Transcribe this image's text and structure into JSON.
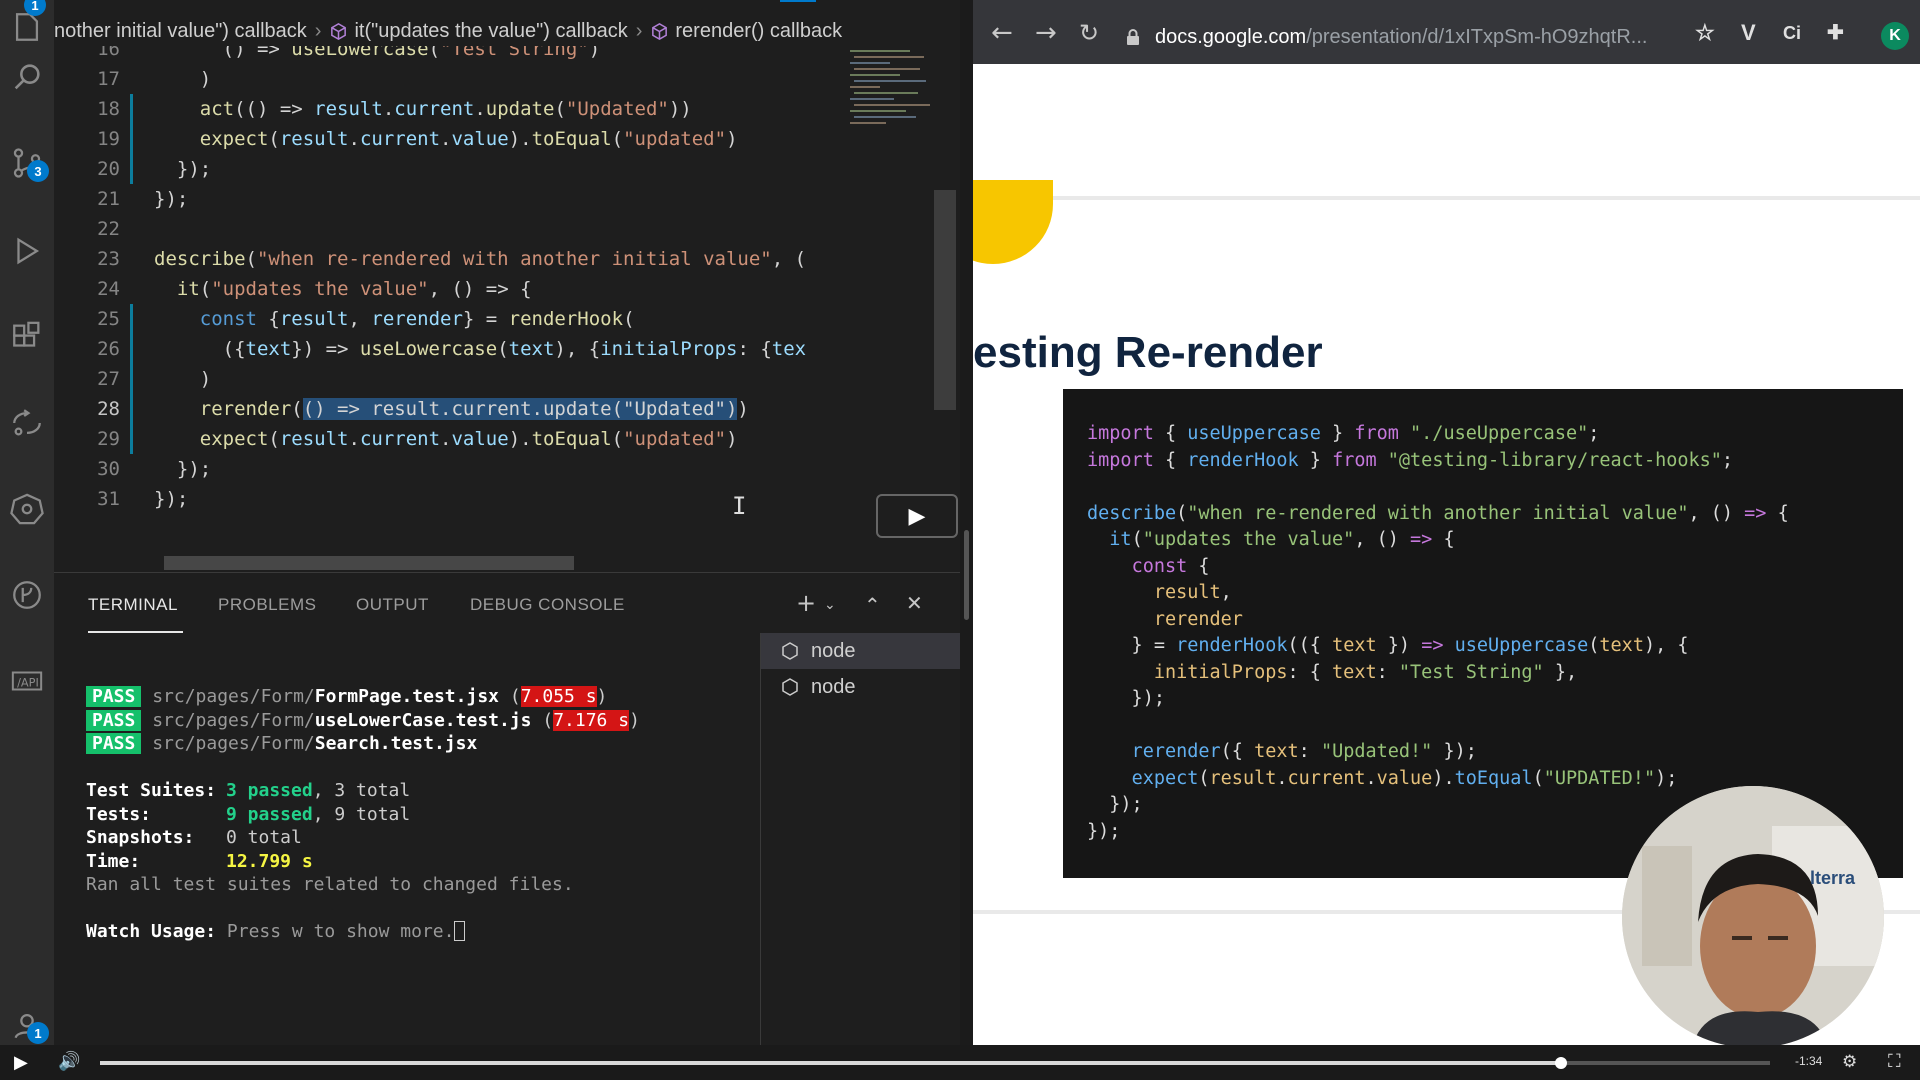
{
  "vscode": {
    "badges": {
      "explorer": "1",
      "source_control": "3",
      "accounts": "1"
    },
    "breadcrumb": [
      "nother initial value\") callback",
      "it(\"updates the value\") callback",
      "rerender() callback"
    ],
    "code_lines": [
      {
        "num": "16",
        "tokens": [
          [
            "pun",
            "      () => "
          ],
          [
            "fn",
            "useLowercase"
          ],
          [
            "pun",
            "("
          ],
          [
            "str",
            "\"Test String\""
          ],
          [
            "pun",
            ")"
          ]
        ]
      },
      {
        "num": "17",
        "tokens": [
          [
            "pun",
            "    )"
          ]
        ]
      },
      {
        "num": "18",
        "tokens": [
          [
            "pun",
            "    "
          ],
          [
            "fn",
            "act"
          ],
          [
            "pun",
            "(() => "
          ],
          [
            "var",
            "result"
          ],
          [
            "pun",
            "."
          ],
          [
            "var",
            "current"
          ],
          [
            "pun",
            "."
          ],
          [
            "fn",
            "update"
          ],
          [
            "pun",
            "("
          ],
          [
            "str",
            "\"Updated\""
          ],
          [
            "pun",
            "))"
          ]
        ]
      },
      {
        "num": "19",
        "tokens": [
          [
            "pun",
            "    "
          ],
          [
            "fn",
            "expect"
          ],
          [
            "pun",
            "("
          ],
          [
            "var",
            "result"
          ],
          [
            "pun",
            "."
          ],
          [
            "var",
            "current"
          ],
          [
            "pun",
            "."
          ],
          [
            "var",
            "value"
          ],
          [
            "pun",
            ")."
          ],
          [
            "fn",
            "toEqual"
          ],
          [
            "pun",
            "("
          ],
          [
            "str",
            "\"updated\""
          ],
          [
            "pun",
            ")"
          ]
        ]
      },
      {
        "num": "20",
        "tokens": [
          [
            "pun",
            "  });"
          ]
        ]
      },
      {
        "num": "21",
        "tokens": [
          [
            "pun",
            "});"
          ]
        ]
      },
      {
        "num": "22",
        "tokens": []
      },
      {
        "num": "23",
        "tokens": [
          [
            "fn",
            "describe"
          ],
          [
            "pun",
            "("
          ],
          [
            "str",
            "\"when re-rendered with another initial value\""
          ],
          [
            "pun",
            ", ("
          ]
        ]
      },
      {
        "num": "24",
        "tokens": [
          [
            "pun",
            "  "
          ],
          [
            "fn",
            "it"
          ],
          [
            "pun",
            "("
          ],
          [
            "str",
            "\"updates the value\""
          ],
          [
            "pun",
            ", () => {"
          ]
        ]
      },
      {
        "num": "25",
        "tokens": [
          [
            "pun",
            "    "
          ],
          [
            "kw",
            "const"
          ],
          [
            "pun",
            " {"
          ],
          [
            "var",
            "result"
          ],
          [
            "pun",
            ", "
          ],
          [
            "var",
            "rerender"
          ],
          [
            "pun",
            "} = "
          ],
          [
            "fn",
            "renderHook"
          ],
          [
            "pun",
            "("
          ]
        ]
      },
      {
        "num": "26",
        "tokens": [
          [
            "pun",
            "      ({"
          ],
          [
            "var",
            "text"
          ],
          [
            "pun",
            "}) => "
          ],
          [
            "fn",
            "useLowercase"
          ],
          [
            "pun",
            "("
          ],
          [
            "var",
            "text"
          ],
          [
            "pun",
            "), {"
          ],
          [
            "var",
            "initialProps"
          ],
          [
            "pun",
            ": {"
          ],
          [
            "var",
            "tex"
          ]
        ]
      },
      {
        "num": "27",
        "tokens": [
          [
            "pun",
            "    )"
          ]
        ]
      },
      {
        "num": "28",
        "tokens": [
          [
            "pun",
            "    "
          ],
          [
            "fn",
            "rerender"
          ],
          [
            "pun",
            "("
          ],
          [
            "sel",
            "() => result.current.update(\"Updated\")"
          ],
          [
            "pun",
            ")"
          ]
        ]
      },
      {
        "num": "29",
        "tokens": [
          [
            "pun",
            "    "
          ],
          [
            "fn",
            "expect"
          ],
          [
            "pun",
            "("
          ],
          [
            "var",
            "result"
          ],
          [
            "pun",
            "."
          ],
          [
            "var",
            "current"
          ],
          [
            "pun",
            "."
          ],
          [
            "var",
            "value"
          ],
          [
            "pun",
            ")."
          ],
          [
            "fn",
            "toEqual"
          ],
          [
            "pun",
            "("
          ],
          [
            "str",
            "\"updated\""
          ],
          [
            "pun",
            ")"
          ]
        ]
      },
      {
        "num": "30",
        "tokens": [
          [
            "pun",
            "  });"
          ]
        ]
      },
      {
        "num": "31",
        "tokens": [
          [
            "pun",
            "});"
          ]
        ]
      }
    ],
    "panel_tabs": [
      "TERMINAL",
      "PROBLEMS",
      "OUTPUT",
      "DEBUG CONSOLE"
    ],
    "terminal": {
      "results": [
        {
          "status": "PASS",
          "dir": "src/pages/Form/",
          "file": "FormPage.test.jsx",
          "time": "7.055 s"
        },
        {
          "status": "PASS",
          "dir": "src/pages/Form/",
          "file": "useLowerCase.test.js",
          "time": "7.176 s"
        },
        {
          "status": "PASS",
          "dir": "src/pages/Form/",
          "file": "Search.test.jsx",
          "time": ""
        }
      ],
      "suites_label": "Test Suites:",
      "suites_passed": "3 passed",
      "suites_total": ", 3 total",
      "tests_label": "Tests:",
      "tests_passed": "9 passed",
      "tests_total": ", 9 total",
      "snapshots_label": "Snapshots:",
      "snapshots_value": "0 total",
      "time_label": "Time:",
      "time_value": "12.799 s",
      "ran_note": "Ran all test suites related to changed files.",
      "watch_label": "Watch Usage:",
      "watch_text": "Press w to show more."
    },
    "terminal_instances": [
      "node",
      "node"
    ]
  },
  "browser": {
    "url_host": "docs.google.com",
    "url_path": "/presentation/d/1xITxpSm-hO9zhqtR...",
    "profile_initial": "K",
    "slide_title": "esting Re-render",
    "slide_code_lines": [
      [
        [
          "s-kw",
          "import"
        ],
        [
          "s-plain",
          " { "
        ],
        [
          "s-fn",
          "useUppercase"
        ],
        [
          "s-plain",
          " } "
        ],
        [
          "s-kw",
          "from"
        ],
        [
          "s-plain",
          " "
        ],
        [
          "s-str",
          "\"./useUppercase\""
        ],
        [
          "s-plain",
          ";"
        ]
      ],
      [
        [
          "s-kw",
          "import"
        ],
        [
          "s-plain",
          " { "
        ],
        [
          "s-fn",
          "renderHook"
        ],
        [
          "s-plain",
          " } "
        ],
        [
          "s-kw",
          "from"
        ],
        [
          "s-plain",
          " "
        ],
        [
          "s-str",
          "\"@testing-library/react-hooks\""
        ],
        [
          "s-plain",
          ";"
        ]
      ],
      [],
      [
        [
          "s-fn",
          "describe"
        ],
        [
          "s-plain",
          "("
        ],
        [
          "s-str",
          "\"when re-rendered with another initial value\""
        ],
        [
          "s-plain",
          ", () "
        ],
        [
          "s-kw",
          "=>"
        ],
        [
          "s-plain",
          " {"
        ]
      ],
      [
        [
          "s-plain",
          "  "
        ],
        [
          "s-fn",
          "it"
        ],
        [
          "s-plain",
          "("
        ],
        [
          "s-str",
          "\"updates the value\""
        ],
        [
          "s-plain",
          ", () "
        ],
        [
          "s-kw",
          "=>"
        ],
        [
          "s-plain",
          " {"
        ]
      ],
      [
        [
          "s-plain",
          "    "
        ],
        [
          "s-kw",
          "const"
        ],
        [
          "s-plain",
          " {"
        ]
      ],
      [
        [
          "s-plain",
          "      "
        ],
        [
          "s-var",
          "result"
        ],
        [
          "s-plain",
          ","
        ]
      ],
      [
        [
          "s-plain",
          "      "
        ],
        [
          "s-var",
          "rerender"
        ]
      ],
      [
        [
          "s-plain",
          "    } = "
        ],
        [
          "s-fn",
          "renderHook"
        ],
        [
          "s-plain",
          "(({ "
        ],
        [
          "s-var",
          "text"
        ],
        [
          "s-plain",
          " }) "
        ],
        [
          "s-kw",
          "=>"
        ],
        [
          "s-plain",
          " "
        ],
        [
          "s-fn",
          "useUppercase"
        ],
        [
          "s-plain",
          "("
        ],
        [
          "s-var",
          "text"
        ],
        [
          "s-plain",
          "), {"
        ]
      ],
      [
        [
          "s-plain",
          "      "
        ],
        [
          "s-var",
          "initialProps"
        ],
        [
          "s-plain",
          ": { "
        ],
        [
          "s-var",
          "text"
        ],
        [
          "s-plain",
          ": "
        ],
        [
          "s-str",
          "\"Test String\""
        ],
        [
          "s-plain",
          " },"
        ]
      ],
      [
        [
          "s-plain",
          "    });"
        ]
      ],
      [],
      [
        [
          "s-plain",
          "    "
        ],
        [
          "s-fn",
          "rerender"
        ],
        [
          "s-plain",
          "({ "
        ],
        [
          "s-var",
          "text"
        ],
        [
          "s-plain",
          ": "
        ],
        [
          "s-str",
          "\"Updated!\""
        ],
        [
          "s-plain",
          " });"
        ]
      ],
      [
        [
          "s-plain",
          "    "
        ],
        [
          "s-fn",
          "expect"
        ],
        [
          "s-plain",
          "("
        ],
        [
          "s-var",
          "result"
        ],
        [
          "s-plain",
          "."
        ],
        [
          "s-var",
          "current"
        ],
        [
          "s-plain",
          "."
        ],
        [
          "s-var",
          "value"
        ],
        [
          "s-plain",
          ")."
        ],
        [
          "s-fn",
          "toEqual"
        ],
        [
          "s-plain",
          "("
        ],
        [
          "s-str",
          "\"UPDATED!\""
        ],
        [
          "s-plain",
          ");"
        ]
      ],
      [
        [
          "s-plain",
          "  });"
        ]
      ],
      [
        [
          "s-plain",
          "});"
        ]
      ]
    ],
    "webcam_watermark": "lterra"
  },
  "video": {
    "time_remaining": "-1:34",
    "progress_fraction": 0.875
  }
}
